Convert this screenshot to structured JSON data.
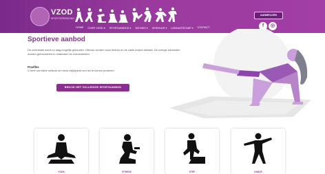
{
  "header": {
    "logo_text": "VZOD",
    "logo_subtitle": "SPORTVERENIGING",
    "nav_items": [
      "HOME",
      "OVER VZOD ▾",
      "SPORTAANBOD ▾",
      "NIEUWS ▾",
      "VERHUUR ▾",
      "LIDMAATSCHAP ▾",
      "CONTACT"
    ],
    "aanmelden_label": "AANMELDEN",
    "social_facebook": "f",
    "social_instagram": "◎"
  },
  "main": {
    "title": "Sportieve aanbod",
    "intro": "De contributie wordt zo laag mogelijk gehouden. Hiervan worden onze leraren en de vaste kosten betaald. De overige inkomsten worden geïnvesteerd in materialen en evenementen.",
    "prijs_heading": "Proefles",
    "prijs_text": "U bent van harte welkom om eens vrijblijvend een les te komen proberen.",
    "cta_label": "BEKIJK HET VOLLEDIGE SPORTAANBOD"
  },
  "cards": [
    {
      "label": "YOGA"
    },
    {
      "label": "FITNESS"
    },
    {
      "label": "STEP"
    },
    {
      "label": "DANCE"
    }
  ],
  "colors": {
    "brand_purple": "#8a3592",
    "header_gradient_start": "#7a2a8a",
    "header_gradient_end": "#a23ea6",
    "hero_accent": "#9b59b6"
  },
  "icons": [
    "logo-emblem-icon",
    "sport-figures-icon",
    "facebook-icon",
    "instagram-icon",
    "yoga-figure-icon",
    "fitness-figure-icon",
    "step-figure-icon",
    "dance-figure-icon"
  ]
}
